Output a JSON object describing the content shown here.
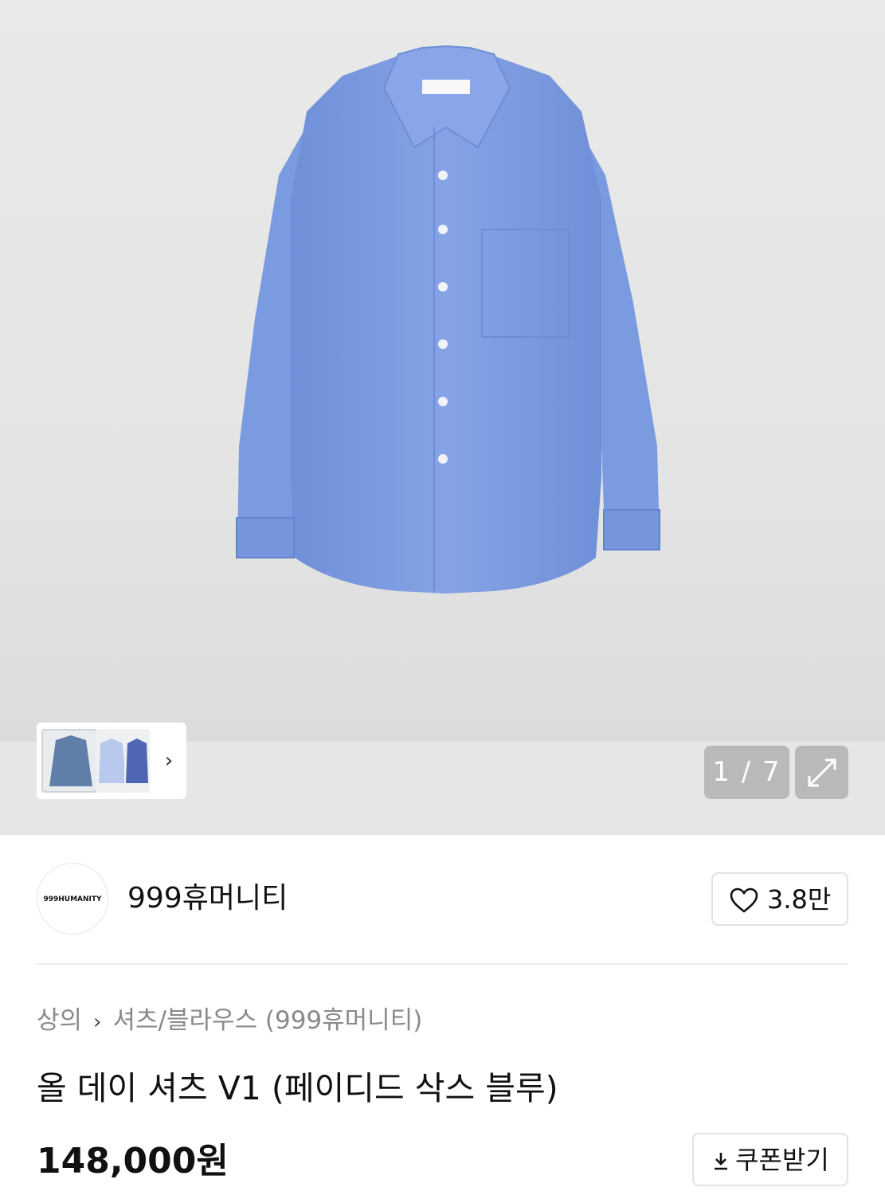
{
  "gallery": {
    "counter": "1 / 7",
    "expand_icon": "expand-icon",
    "next_icon": "chevron-right-icon"
  },
  "brand": {
    "logo_text": "999HUMANITY",
    "name": "999휴머니티",
    "like_count": "3.8만"
  },
  "breadcrumb": {
    "level1": "상의",
    "level2": "셔츠/블라우스 (999휴머니티)"
  },
  "product": {
    "title": "올 데이 셔츠 V1 (페이디드 삭스 블루)",
    "price": "148,000원"
  },
  "coupon": {
    "label": "쿠폰받기"
  },
  "colors": {
    "shirt": "#7f9fe3",
    "overlay": "#b9b9b9"
  }
}
